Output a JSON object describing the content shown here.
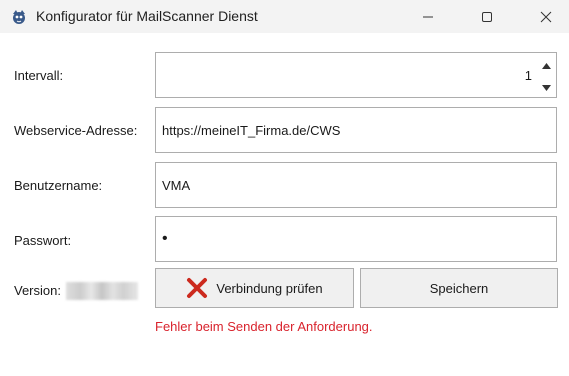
{
  "window": {
    "title": "Konfigurator für MailScanner Dienst",
    "icon": "mailscanner-app-icon",
    "controls": [
      "minimize-icon",
      "maximize-icon",
      "close-icon"
    ]
  },
  "form": {
    "interval": {
      "label": "Intervall:",
      "value": "1"
    },
    "webservice": {
      "label": "Webservice-Adresse:",
      "value": "https://meineIT_Firma.de/CWS"
    },
    "username": {
      "label": "Benutzername:",
      "value": "VMA"
    },
    "password": {
      "label": "Passwort:",
      "value": "•"
    },
    "version": {
      "label": "Version:"
    }
  },
  "buttons": {
    "test_connection": "Verbindung prüfen",
    "save": "Speichern"
  },
  "error_message": "Fehler beim Senden der Anforderung.",
  "colors": {
    "error": "#d9232d",
    "test_icon": "#cc2a1e"
  }
}
